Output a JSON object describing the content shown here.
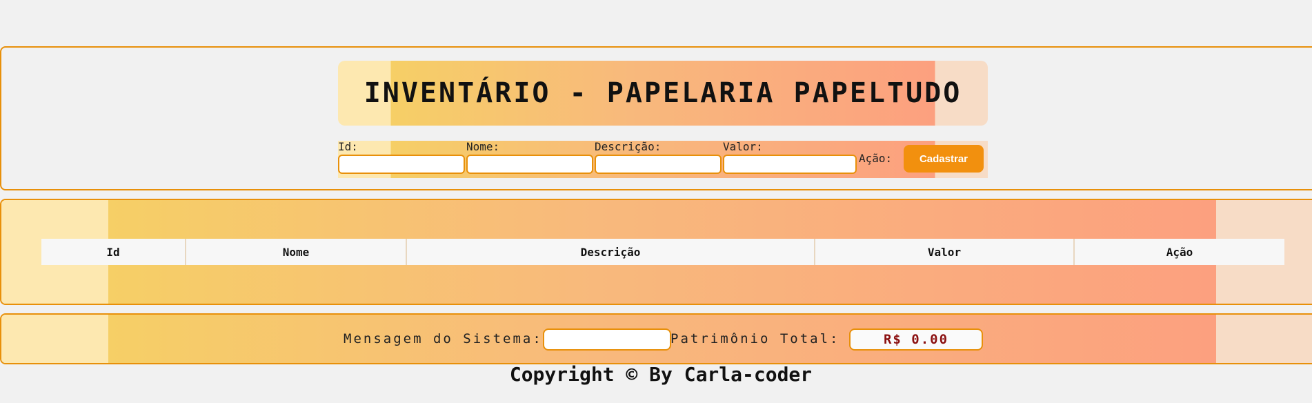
{
  "header": {
    "title": "INVENTÁRIO - PAPELARIA PAPELTUDO"
  },
  "form": {
    "id_label": "Id:",
    "nome_label": "Nome:",
    "descricao_label": "Descrição:",
    "valor_label": "Valor:",
    "acao_label": "Ação:",
    "submit_label": "Cadastrar",
    "id_value": "",
    "nome_value": "",
    "descricao_value": "",
    "valor_value": ""
  },
  "table": {
    "columns": [
      "Id",
      "Nome",
      "Descrição",
      "Valor",
      "Ação"
    ],
    "rows": []
  },
  "footer": {
    "message_label": "Mensagem do Sistema:",
    "message_value": "",
    "patrimonio_label": "Patrimônio Total:",
    "patrimonio_value": "R$ 0.00"
  },
  "copyright": "Copyright © By Carla-coder",
  "colors": {
    "accent": "#e8900a",
    "button": "#f2900e",
    "gradient_start": "#f6cf66",
    "gradient_end": "#fca07f",
    "value_text": "#8b1010"
  }
}
